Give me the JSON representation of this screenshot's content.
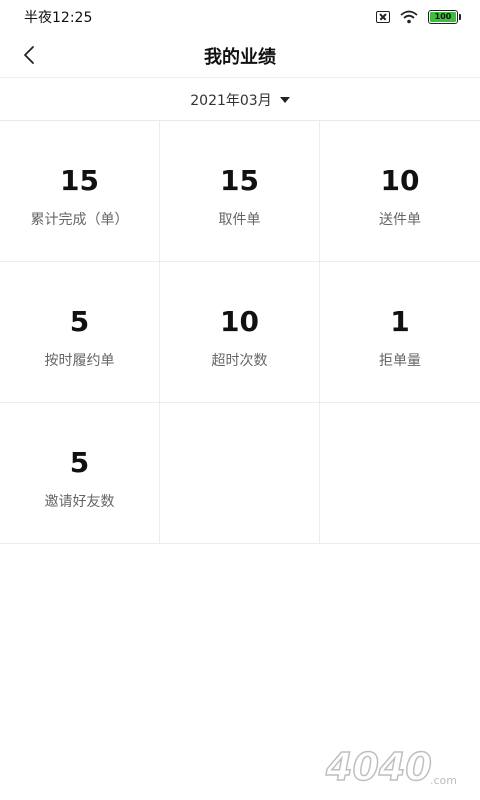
{
  "statusbar": {
    "time": "半夜12:25",
    "battery": "100",
    "icons": [
      "sim-off-icon",
      "wifi-icon",
      "battery-icon"
    ]
  },
  "header": {
    "title": "我的业绩",
    "back_icon": "chevron-left-icon"
  },
  "month_selector": {
    "value": "2021年03月",
    "icon": "caret-down-icon"
  },
  "stats": [
    {
      "value": "15",
      "label": "累计完成（单）"
    },
    {
      "value": "15",
      "label": "取件单"
    },
    {
      "value": "10",
      "label": "送件单"
    },
    {
      "value": "5",
      "label": "按时履约单"
    },
    {
      "value": "10",
      "label": "超时次数"
    },
    {
      "value": "1",
      "label": "拒单量"
    },
    {
      "value": "5",
      "label": "邀请好友数"
    }
  ],
  "watermark": {
    "text": "4040",
    "suffix": ".com"
  },
  "colors": {
    "background": "#ffffff",
    "divider": "#ececec",
    "value_text": "#111111",
    "label_text": "#666666",
    "battery_fill": "#3dbe3d"
  }
}
